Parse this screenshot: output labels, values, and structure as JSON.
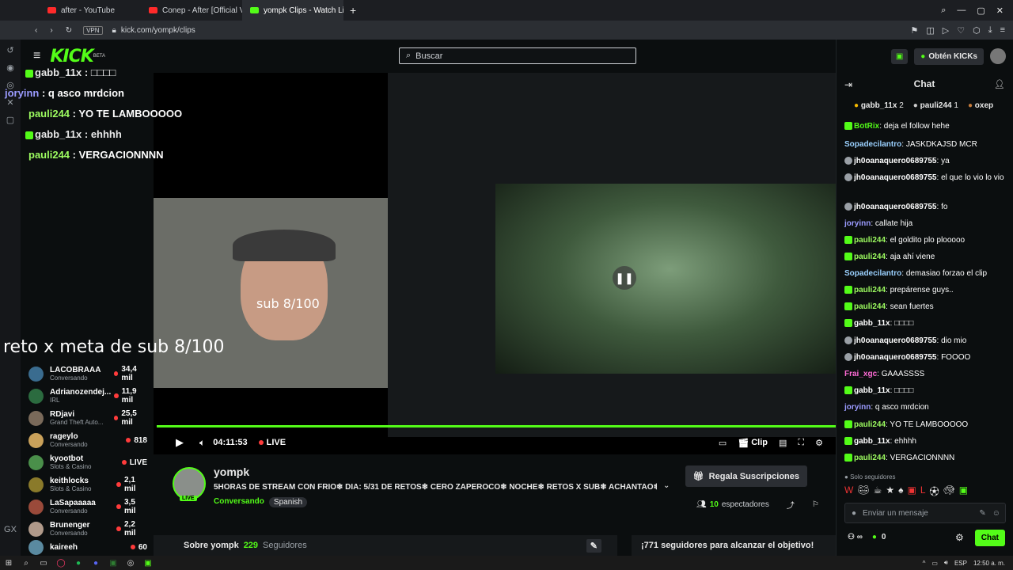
{
  "browser": {
    "tabs": [
      {
        "label": "after - YouTube",
        "active": false
      },
      {
        "label": "Conep - After [Official Vide",
        "active": false
      },
      {
        "label": "yompk Clips - Watch Live c",
        "active": true
      }
    ],
    "url": "kick.com/yompk/clips",
    "vpn_label": "VPN"
  },
  "kick": {
    "logo": "KICK",
    "logo_sup": "BETA",
    "search_placeholder": "Buscar"
  },
  "stream_overlay": {
    "chat_lines": [
      {
        "user": "gabb_11x",
        "text": " : □□□□",
        "color": "#ffffff"
      },
      {
        "user": "joryinn",
        "text": " : q asco mrdcion",
        "color": "#9b9bff"
      },
      {
        "user": "pauli244",
        "text": " : YO TE LAMBOOOOO",
        "color": "#9dfc60"
      },
      {
        "user": "gabb_11x",
        "text": " : ehhhh",
        "color": "#ffffff"
      },
      {
        "user": "pauli244",
        "text": " : VERGACIONNNN",
        "color": "#9dfc60"
      }
    ],
    "sub_goal": "sub 8/100",
    "reto_text": "reto x meta de sub 8/100"
  },
  "sidebar_channels": [
    {
      "name": "LACOBRAAA",
      "category": "Conversando",
      "viewers": "34,4 mil"
    },
    {
      "name": "Adrianozendej...",
      "category": "IRL",
      "viewers": "11,9 mil"
    },
    {
      "name": "RDjavi",
      "category": "Grand Theft Auto...",
      "viewers": "25,5 mil"
    },
    {
      "name": "rageylo",
      "category": "Conversando",
      "viewers": "818"
    },
    {
      "name": "kyootbot",
      "category": "Slots & Casino",
      "viewers": "LIVE"
    },
    {
      "name": "keithlocks",
      "category": "Slots & Casino",
      "viewers": "2,1 mil"
    },
    {
      "name": "LaSapaaaaa",
      "category": "Conversando",
      "viewers": "3,5 mil"
    },
    {
      "name": "Brunenger",
      "category": "Conversando",
      "viewers": "2,2 mil"
    },
    {
      "name": "kaireeh",
      "category": "",
      "viewers": "60"
    }
  ],
  "player": {
    "time": "04:11:53",
    "live_label": "LIVE",
    "clip_label": "Clip",
    "progress": 1.0
  },
  "channel_info": {
    "name": "yompk",
    "title": "5HORAS DE STREAM CON FRIO❄ DIA: 5/31 DE RETOS❄ CERO ZAPEROCO❄ NOCHE❄ RETOS X SUB❄ ACHANTAO❄ EN ...",
    "category": "Conversando",
    "language": "Spanish",
    "subscribe_label": "Regala Suscripciones",
    "viewers": "10",
    "viewers_label": "espectadores",
    "about_label": "Sobre yompk",
    "followers": "229",
    "followers_label": "Seguidores",
    "goal_text": "¡771 seguidores para alcanzar el objetivo!",
    "live_badge": "LIVE"
  },
  "chat": {
    "kicks_label": "Obtén KICKs",
    "title": "Chat",
    "leaderboard": [
      {
        "user": "gabb_11x",
        "count": "2"
      },
      {
        "user": "pauli244",
        "count": "1"
      },
      {
        "user": "oxep",
        "count": ""
      }
    ],
    "messages": [
      {
        "user": "BotRix",
        "text": "deja el follow hehe",
        "color": "#53fc18"
      },
      {
        "user": "Sopadecilantro",
        "text": "JASKDKAJSD MCR",
        "color": "#9bd1ff"
      },
      {
        "user": "jh0oanaquero0689755",
        "text": "ya",
        "color": "#ffffff"
      },
      {
        "user": "jh0oanaquero0689755",
        "text": "el que lo vio lo vio",
        "color": "#ffffff"
      },
      {
        "user": "jh0oanaquero0689755",
        "text": "fo",
        "color": "#ffffff"
      },
      {
        "user": "joryinn",
        "text": "callate hija",
        "color": "#9b9bff"
      },
      {
        "user": "pauli244",
        "text": "el goldito plo plooooo",
        "color": "#9dfc60"
      },
      {
        "user": "pauli244",
        "text": "aja ahí viene",
        "color": "#9dfc60"
      },
      {
        "user": "Sopadecilantro",
        "text": "demasiao forzao el clip",
        "color": "#9bd1ff"
      },
      {
        "user": "pauli244",
        "text": "prepárense guys..",
        "color": "#9dfc60"
      },
      {
        "user": "pauli244",
        "text": "sean fuertes",
        "color": "#9dfc60"
      },
      {
        "user": "gabb_11x",
        "text": "□□□□",
        "color": "#ffffff"
      },
      {
        "user": "jh0oanaquero0689755",
        "text": "dio mio",
        "color": "#ffffff"
      },
      {
        "user": "jh0oanaquero0689755",
        "text": "FOOOO",
        "color": "#ffffff"
      },
      {
        "user": "Frai_xgc",
        "text": "GAAASSSS",
        "color": "#ff6bd6"
      },
      {
        "user": "gabb_11x",
        "text": "□□□□",
        "color": "#ffffff"
      },
      {
        "user": "joryinn",
        "text": "q asco mrdcion",
        "color": "#9b9bff"
      },
      {
        "user": "pauli244",
        "text": "YO TE LAMBOOOOO",
        "color": "#9dfc60"
      },
      {
        "user": "gabb_11x",
        "text": "ehhhh",
        "color": "#ffffff"
      },
      {
        "user": "pauli244",
        "text": "VERGACIONNNN",
        "color": "#9dfc60"
      }
    ],
    "followers_only": "Solo seguidores",
    "input_placeholder": "Enviar un mensaje",
    "points": "0",
    "send_label": "Chat"
  },
  "taskbar": {
    "lang": "ESP",
    "clock": "12:50 a. m."
  },
  "colors": {
    "accent": "#53fc18",
    "background": "#0b0e0f"
  }
}
